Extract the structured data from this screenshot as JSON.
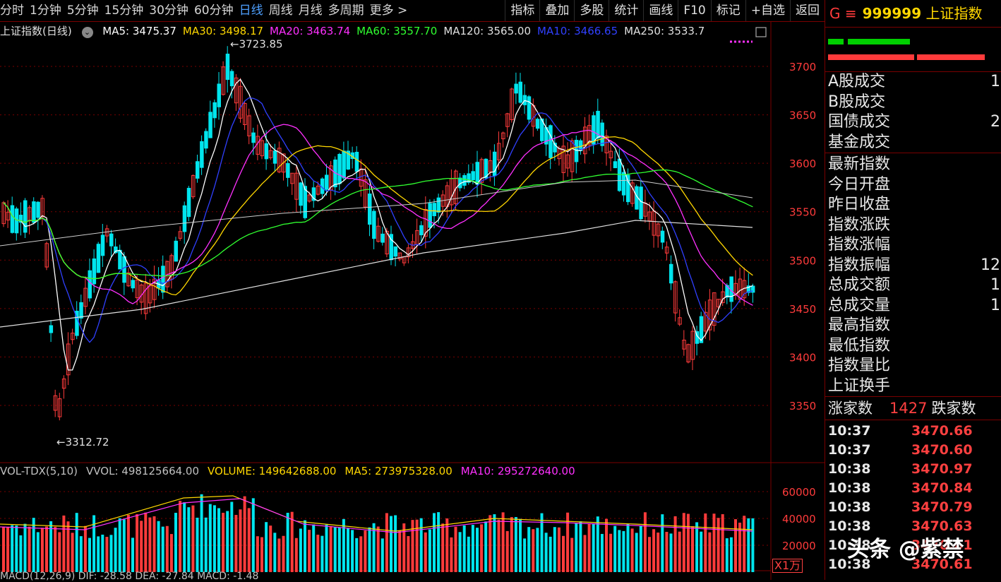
{
  "toolbar": {
    "periods": [
      "分时",
      "1分钟",
      "5分钟",
      "15分钟",
      "30分钟",
      "60分钟",
      "日线",
      "周线",
      "月线",
      "多周期",
      "更多 >"
    ],
    "active": "日线",
    "buttons": [
      "指标",
      "叠加",
      "多股",
      "统计",
      "画线",
      "F10",
      "标记",
      "+自选",
      "返回"
    ]
  },
  "ma_legend": {
    "name": "上证指数(日线)",
    "items": [
      {
        "label": "MA5: 3475.37",
        "color": "#ffffff"
      },
      {
        "label": "MA30: 3498.17",
        "color": "#ffd700"
      },
      {
        "label": "MA20: 3463.74",
        "color": "#ff30ff"
      },
      {
        "label": "MA60: 3557.70",
        "color": "#30ff30"
      },
      {
        "label": "MA120: 3565.00",
        "color": "#e0e0e0"
      },
      {
        "label": "MA10: 3466.65",
        "color": "#3040ff"
      },
      {
        "label": "MA250: 3533.7",
        "color": "#e0e0e0"
      }
    ]
  },
  "annotations": {
    "high": "3723.85",
    "low": "3312.72"
  },
  "price_axis": [
    "3700",
    "3650",
    "3600",
    "3550",
    "3500",
    "3450",
    "3400",
    "3350"
  ],
  "volume_legend": [
    {
      "label": "VOL-TDX(5,10)",
      "color": "#c0c0c0"
    },
    {
      "label": "VVOL: 498125664.00",
      "color": "#c0c0c0"
    },
    {
      "label": "VOLUME: 149642688.00",
      "color": "#ffd700"
    },
    {
      "label": "MA5: 273975328.00",
      "color": "#ffd700"
    },
    {
      "label": "MA10: 295272640.00",
      "color": "#ff30ff"
    }
  ],
  "volume_axis": [
    "60000",
    "40000",
    "20000"
  ],
  "volume_unit": "X1万",
  "macd_line": "MACD(12,26,9)  DIF: -28.58  DEA: -27.84  MACD: -1.48",
  "panel": {
    "code_prefix": "G ≡",
    "code": "999999",
    "name": "上证指数",
    "turnover_rows": [
      {
        "label": "A股成交",
        "value": "1"
      },
      {
        "label": "B股成交",
        "value": ""
      },
      {
        "label": "国债成交",
        "value": "2"
      },
      {
        "label": "基金成交",
        "value": ""
      }
    ],
    "index_rows": [
      {
        "label": "最新指数",
        "value": ""
      },
      {
        "label": "今日开盘",
        "value": ""
      },
      {
        "label": "昨日收盘",
        "value": ""
      },
      {
        "label": "指数涨跌",
        "value": ""
      },
      {
        "label": "指数涨幅",
        "value": ""
      },
      {
        "label": "指数振幅",
        "value": "12"
      },
      {
        "label": "总成交额",
        "value": "1"
      },
      {
        "label": "总成交量",
        "value": "1"
      },
      {
        "label": "最高指数",
        "value": ""
      },
      {
        "label": "最低指数",
        "value": ""
      },
      {
        "label": "指数量比",
        "value": ""
      },
      {
        "label": "上证换手",
        "value": ""
      }
    ],
    "rise_label": "涨家数",
    "rise_count": "1427",
    "fall_label": "跌家数",
    "ticks": [
      {
        "time": "10:37",
        "price": "3470.66"
      },
      {
        "time": "10:37",
        "price": "3470.60"
      },
      {
        "time": "10:38",
        "price": "3470.97"
      },
      {
        "time": "10:38",
        "price": "3470.84"
      },
      {
        "time": "10:38",
        "price": "3470.79"
      },
      {
        "time": "10:38",
        "price": "3470.63"
      },
      {
        "time": "10:38",
        "price": "3470.61"
      },
      {
        "time": "10:38",
        "price": "3470.61"
      }
    ]
  },
  "watermark": "头条 @紫禁",
  "colors": {
    "up": "#ff3b3b",
    "down": "#00e5ee",
    "grid": "#7a0000"
  }
}
